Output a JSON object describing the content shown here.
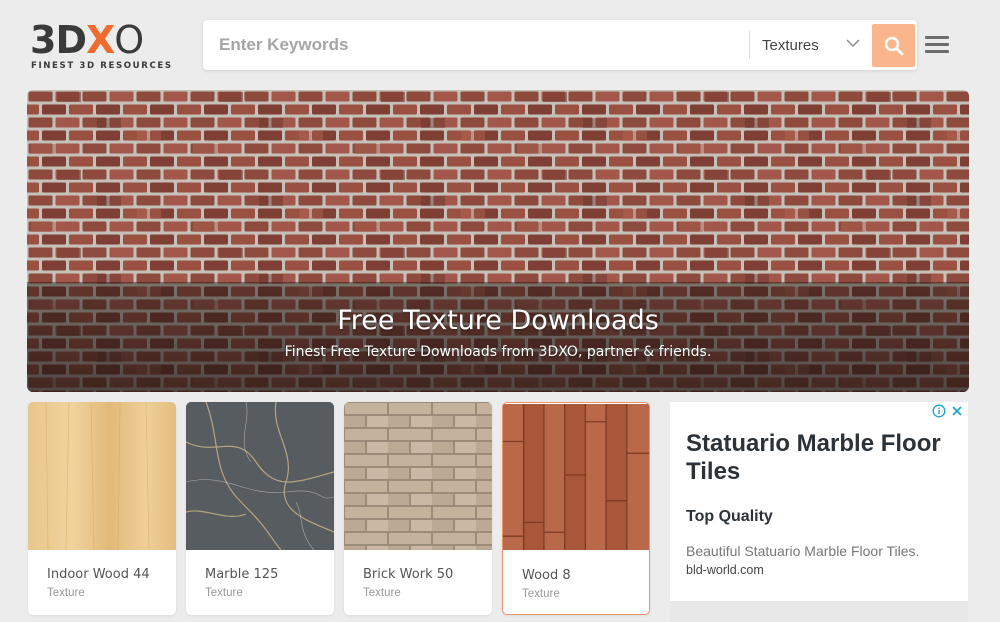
{
  "header": {
    "logo": {
      "text_main": "3D",
      "text_x": "X",
      "text_o": "O",
      "tagline": "FINEST 3D RESOURCES"
    },
    "search": {
      "placeholder": "Enter Keywords",
      "value": ""
    },
    "category": {
      "selected": "Textures"
    },
    "colors": {
      "accent": "#f26a2e",
      "search_button": "#fbb58d"
    }
  },
  "hero": {
    "title": "Free Texture Downloads",
    "subtitle": "Finest Free Texture Downloads from 3DXO, partner & friends."
  },
  "cards": [
    {
      "name": "Indoor Wood 44",
      "type": "Texture"
    },
    {
      "name": "Marble 125",
      "type": "Texture"
    },
    {
      "name": "Brick Work 50",
      "type": "Texture"
    },
    {
      "name": "Wood 8",
      "type": "Texture"
    }
  ],
  "ad": {
    "title": "Statuario Marble Floor Tiles",
    "subtitle": "Top Quality",
    "description": "Beautiful Statuario Marble Floor Tiles.",
    "url": "bld-world.com",
    "icons": [
      "info-icon",
      "close-icon"
    ]
  }
}
